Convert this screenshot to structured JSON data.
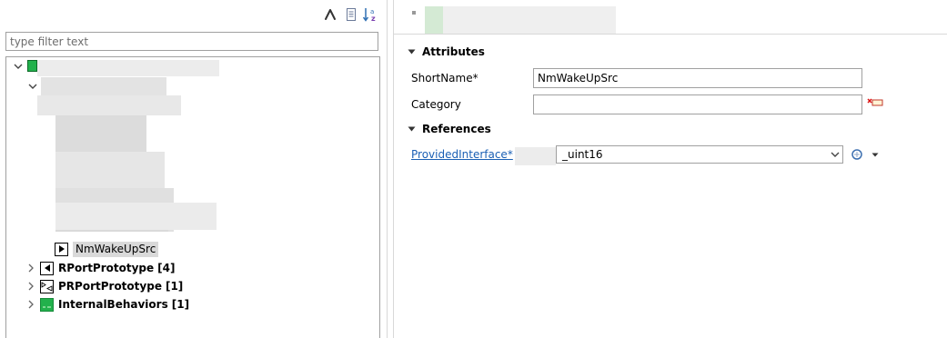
{
  "left": {
    "filter_placeholder": "type filter text",
    "tree": {
      "selected_node": "NmWakeUpSrc",
      "nodes": [
        {
          "label": "RPortPrototype",
          "count": "[4]"
        },
        {
          "label": "PRPortPrototype",
          "count": "[1]"
        },
        {
          "label": "InternalBehaviors",
          "count": "[1]"
        }
      ]
    }
  },
  "right": {
    "attributes_heading": "Attributes",
    "shortname_label": "ShortName*",
    "shortname_value": "NmWakeUpSrc",
    "category_label": "Category",
    "category_value": "",
    "references_heading": "References",
    "provided_interface_label": "ProvidedInterface*",
    "provided_interface_value": "_uint16"
  },
  "colors": {
    "link": "#1a5fb4",
    "selection": "#d9d9d9",
    "border": "#a0a0a0",
    "green_icon": "#22b14c"
  },
  "icons": {
    "toolbar": [
      "collapse-icon",
      "document-icon",
      "sort-az-icon"
    ],
    "category_action": "remove-category-icon",
    "reference_action": "browse-reference-icon",
    "reference_menu": "dropdown-menu-icon"
  }
}
